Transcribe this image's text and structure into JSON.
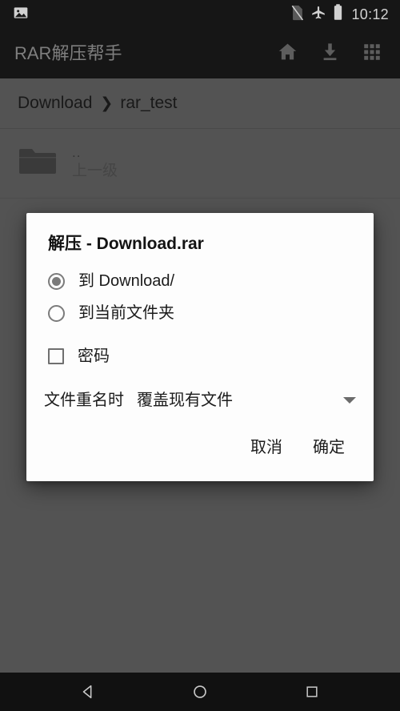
{
  "status_bar": {
    "time": "10:12",
    "icons": [
      {
        "name": "photo-icon"
      },
      {
        "name": "no-sim-icon"
      },
      {
        "name": "airplane-mode-icon"
      },
      {
        "name": "battery-icon"
      }
    ]
  },
  "app_bar": {
    "title": "RAR解压帮手",
    "actions": [
      {
        "name": "home-icon"
      },
      {
        "name": "download-icon"
      },
      {
        "name": "apps-grid-icon"
      }
    ]
  },
  "breadcrumb": {
    "root": "Download",
    "separator": "❯",
    "current": "rar_test"
  },
  "file_list": [
    {
      "icon": "folder-icon",
      "name": "..",
      "subtitle": "上一级"
    }
  ],
  "dialog": {
    "title": "解压 - Download.rar",
    "destination_options": [
      {
        "label": "到 Download/",
        "selected": true
      },
      {
        "label": "到当前文件夹",
        "selected": false
      }
    ],
    "password": {
      "label": "密码",
      "checked": false
    },
    "conflict": {
      "caption": "文件重名时",
      "value": "覆盖现有文件",
      "caret": "dropdown-caret-icon"
    },
    "buttons": {
      "cancel": "取消",
      "confirm": "确定"
    }
  },
  "nav_bar": {
    "back": "back-triangle-icon",
    "home": "home-circle-icon",
    "recents": "recents-square-icon"
  },
  "colors": {
    "status_bar_bg": "#1c1c1c",
    "app_bar_bg": "#1c1c1c",
    "content_bg": "#666666",
    "dialog_bg": "#fdfdfd",
    "nav_bar_bg": "#111111",
    "app_title": "#9a9a9a"
  }
}
